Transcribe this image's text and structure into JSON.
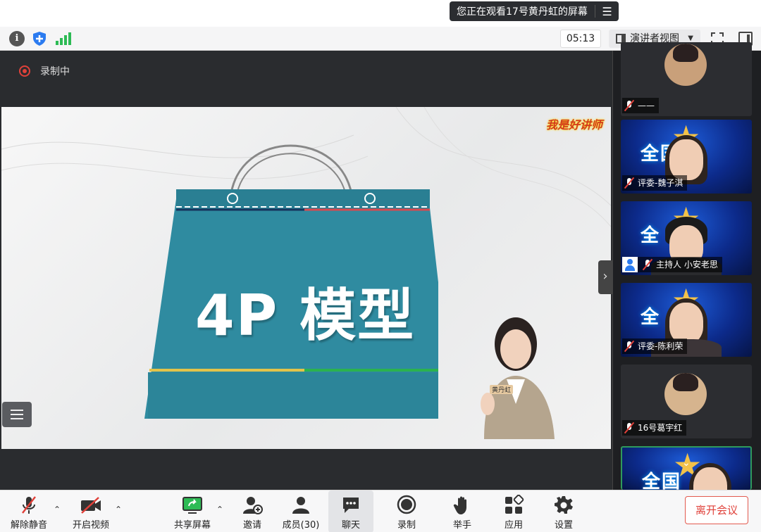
{
  "window": {
    "watch_banner": "您正在观看17号黄丹虹的屏幕",
    "menu_icon": "list-menu-icon"
  },
  "toolbar": {
    "timer": "05:13",
    "view_mode": "演讲者视图",
    "icons": [
      "info-icon",
      "shield-icon",
      "signal-icon",
      "fullscreen-icon",
      "sidebar-toggle-icon"
    ]
  },
  "stage": {
    "recording_label": "录制中",
    "slide": {
      "title": "4P 模型",
      "logo_text": "我是好讲师",
      "presenter_badge": "黄丹虹"
    }
  },
  "participants": [
    {
      "name": "——",
      "muted": true
    },
    {
      "name": "评委-魏子淇",
      "muted": true
    },
    {
      "name": "主持人 小安老思",
      "muted": true,
      "host": true
    },
    {
      "name": "评委-陈利荣",
      "muted": true
    },
    {
      "name": "16号葛宇红",
      "muted": true
    },
    {
      "name": "",
      "muted": false
    }
  ],
  "bottom_bar": {
    "unmute": "解除静音",
    "start_video": "开启视频",
    "share_screen": "共享屏幕",
    "invite": "邀请",
    "members": "成员(30)",
    "chat": "聊天",
    "record": "录制",
    "raise_hand": "举手",
    "apps": "应用",
    "settings": "设置",
    "leave": "离开会议"
  },
  "colors": {
    "bag": "#2e8a9e",
    "record_red": "#e0413a",
    "signal_green": "#2dbb55",
    "panel_bg": "#1e1f22"
  }
}
